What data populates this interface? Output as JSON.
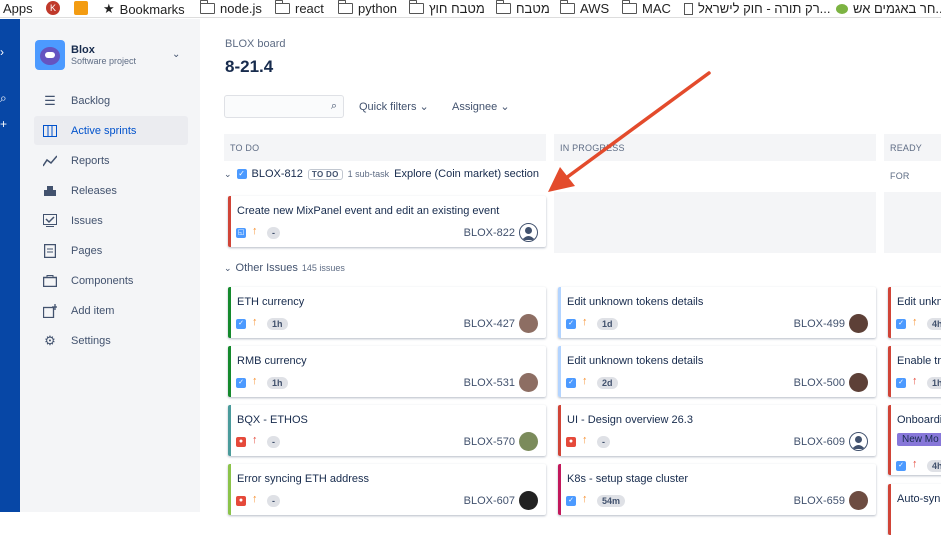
{
  "bookmarks": {
    "apps": "Apps",
    "bookmarks": "Bookmarks",
    "nodejs": "node.js",
    "react": "react",
    "python": "python",
    "heb1": "מטבח חוץ",
    "heb2": "מטבח",
    "aws": "AWS",
    "mac": "MAC",
    "heb3": "רק תורה - חוק לישראל...",
    "heb4": "חר באגמים אש..."
  },
  "project": {
    "name": "Blox",
    "type": "Software project"
  },
  "sidebar": {
    "items": [
      {
        "label": "Backlog",
        "icon": "backlog-icon"
      },
      {
        "label": "Active sprints",
        "icon": "board-icon"
      },
      {
        "label": "Reports",
        "icon": "reports-icon"
      },
      {
        "label": "Releases",
        "icon": "releases-icon"
      },
      {
        "label": "Issues",
        "icon": "issues-icon"
      },
      {
        "label": "Pages",
        "icon": "pages-icon"
      },
      {
        "label": "Components",
        "icon": "components-icon"
      },
      {
        "label": "Add item",
        "icon": "add-item-icon"
      },
      {
        "label": "Settings",
        "icon": "settings-icon"
      }
    ]
  },
  "header": {
    "breadcrumb": "BLOX board",
    "title": "8-21.4"
  },
  "filters": {
    "quick": "Quick filters",
    "assignee": "Assignee"
  },
  "columns": [
    "TO DO",
    "IN PROGRESS",
    "READY FOR"
  ],
  "swimlane1": {
    "key": "BLOX-812",
    "status": "TO DO",
    "subtasks": "1 sub-task",
    "summary": "Explore (Coin market) section"
  },
  "swimlane2": {
    "label": "Other Issues",
    "count": "145 issues"
  },
  "parent_card": {
    "summary": "Create new MixPanel event and edit an existing event",
    "key": "BLOX-822",
    "estimate": "-"
  },
  "todo_cards": [
    {
      "summary": "ETH currency",
      "key": "BLOX-427",
      "estimate": "1h"
    },
    {
      "summary": "RMB currency",
      "key": "BLOX-531",
      "estimate": "1h"
    },
    {
      "summary": "BQX - ETHOS",
      "key": "BLOX-570",
      "estimate": "-"
    },
    {
      "summary": "Error syncing ETH address",
      "key": "BLOX-607",
      "estimate": "-"
    }
  ],
  "progress_cards": [
    {
      "summary": "Edit unknown tokens details",
      "key": "BLOX-499",
      "estimate": "1d"
    },
    {
      "summary": "Edit unknown tokens details",
      "key": "BLOX-500",
      "estimate": "2d"
    },
    {
      "summary": "UI - Design overview 26.3",
      "key": "BLOX-609",
      "estimate": "-"
    },
    {
      "summary": "K8s - setup stage cluster",
      "key": "BLOX-659",
      "estimate": "54m"
    }
  ],
  "ready_cards": [
    {
      "summary": "Edit unkn",
      "estimate": "4h"
    },
    {
      "summary": "Enable tr",
      "estimate": "1h"
    },
    {
      "summary": "Onboardi",
      "label": "New Mo",
      "estimate": "4h"
    },
    {
      "summary": "Auto-syn"
    }
  ],
  "colors": {
    "nav": "#0747a6",
    "story": "#4c9aff",
    "bug": "#e5493a",
    "arrow": "#e34b2c",
    "high": "#e5493a",
    "medium": "#f79232"
  }
}
